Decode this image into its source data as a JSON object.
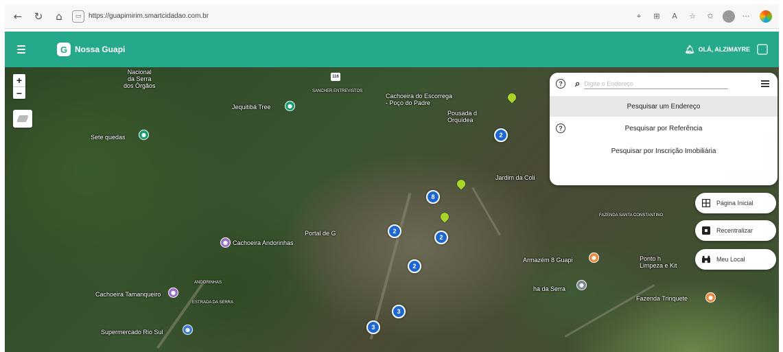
{
  "browser": {
    "url": "https://guapimirim.smartcidadao.com.br",
    "icons": [
      "back-icon",
      "refresh-icon",
      "home-icon",
      "site-info-icon",
      "location-icon",
      "grid-icon",
      "read-aloud-icon",
      "favorite-icon",
      "favorites-icon",
      "profile-icon",
      "more-icon",
      "copilot-icon"
    ]
  },
  "header": {
    "brand": "Nossa Guapi",
    "logo_letter": "G",
    "user_greeting": "OLÁ, ALZIMAYRE",
    "color": "#26a88a"
  },
  "map_labels": [
    {
      "text": "Nacional da Serra dos Órgãos",
      "lines": [
        "Nacional",
        "da Serra",
        "dos Órgãos"
      ]
    },
    {
      "text": "Jequitibá Tree"
    },
    {
      "text": "Sete quedas"
    },
    {
      "text": "Cachoeira do Escorrega - Poço do Padre",
      "lines": [
        "Cachoeira do Escorrega",
        "- Poço do Padre"
      ]
    },
    {
      "text": "Pousada d Orquídea",
      "lines": [
        "Pousada d",
        "Orquídea"
      ]
    },
    {
      "text": "Jardim da Coli"
    },
    {
      "text": "Portal de G"
    },
    {
      "text": "Cachoeira Andorinhas"
    },
    {
      "text": "Cachoeira Tamanqueiro"
    },
    {
      "text": "Supermercado Rio Sul"
    },
    {
      "text": "Armazém 8 Guapi"
    },
    {
      "text": "Ponto h Limpeza e Kit",
      "lines": [
        "Ponto h",
        "Limpeza e Kit"
      ]
    },
    {
      "text": "Fazenda Trinquete"
    },
    {
      "text": "ha da Serra"
    }
  ],
  "small_labels": [
    "SANCHER ENTREVISTOS",
    "FAZENDA SANTA CONSTANTINO",
    "ANDORINHAS",
    "ESTRADA DA SERRA"
  ],
  "clusters": [
    "2",
    "8",
    "2",
    "2",
    "2",
    "3",
    "3"
  ],
  "search": {
    "placeholder": "Digite o Endereço",
    "options": [
      "Pesquisar um Endereço",
      "Pesquisar por Referência",
      "Pesquisar por Inscrição Imobiliária"
    ],
    "selected_index": 0
  },
  "side_buttons": [
    {
      "label": "Página Inicial",
      "icon": "grid-icon"
    },
    {
      "label": "Recentralizar",
      "icon": "recenter-icon"
    },
    {
      "label": "Meu Local",
      "icon": "binoculars-icon"
    }
  ],
  "zoom": {
    "in": "+",
    "out": "−"
  }
}
